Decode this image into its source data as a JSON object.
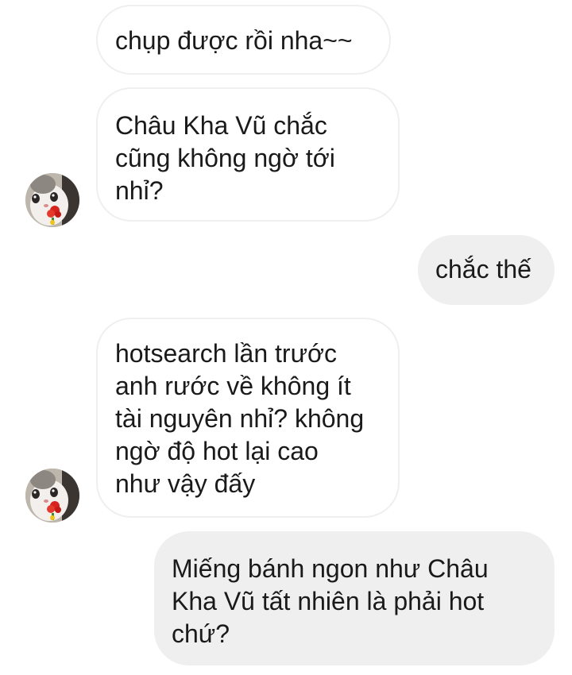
{
  "chat": {
    "messages": [
      {
        "side": "incoming",
        "text": "chụp được rồi nha~~"
      },
      {
        "side": "incoming",
        "text": "Châu Kha Vũ chắc\ncũng không ngờ tới\nnhỉ?"
      },
      {
        "side": "outgoing",
        "text": "chắc thế"
      },
      {
        "side": "incoming",
        "text": "hotsearch lần trước\nanh rước về không ít\ntài nguyên nhỉ? không\nngờ độ hot lại cao\nnhư vậy đấy"
      },
      {
        "side": "outgoing",
        "text": "Miếng bánh ngon như Châu\nKha Vũ tất nhiên là phải hot\nchứ?"
      }
    ]
  },
  "colors": {
    "incoming_bubble": "#ffffff",
    "incoming_border": "#efefef",
    "outgoing_bubble": "#efefef",
    "text": "#1a1a1a"
  },
  "icons": {
    "avatar": "cat-with-rose-avatar"
  }
}
